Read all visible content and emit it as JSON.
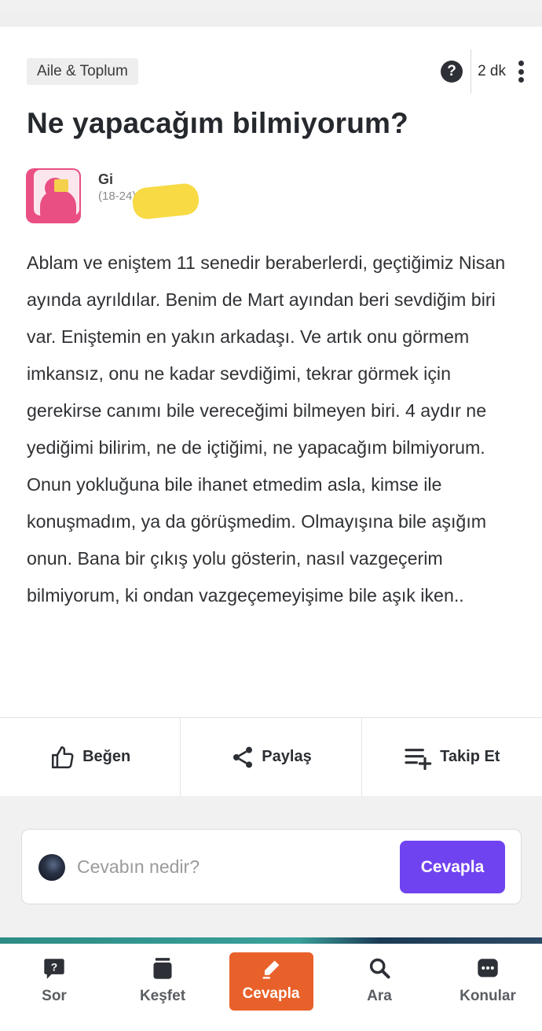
{
  "post": {
    "category": "Aile & Toplum",
    "time": "2 dk",
    "title": "Ne yapacağım bilmiyorum?",
    "author_name": "Gi",
    "author_age": "(18-24)",
    "body": "Ablam ve eniştem 11 senedir beraberlerdi, geçtiğimiz Nisan ayında ayrıldılar. Benim de Mart ayından beri sevdiğim biri var. Eniştemin en yakın arkadaşı. Ve artık onu görmem imkansız, onu ne kadar sevdiğimi, tekrar görmek için gerekirse canımı bile vereceğimi bilmeyen biri. 4 aydır ne yediğimi bilirim, ne de içtiğimi, ne yapacağım bilmiyorum. Onun yokluğuna bile ihanet etmedim asla, kimse ile konuşmadım, ya da görüşmedim. Olmayışına bile aşığım onun. Bana bir çıkış yolu gösterin, nasıl vazgeçerim bilmiyorum, ki ondan vazgeçemeyişime bile aşık iken.."
  },
  "actions": {
    "like": "Beğen",
    "share": "Paylaş",
    "follow": "Takip Et"
  },
  "answer": {
    "placeholder": "Cevabın nedir?",
    "button": "Cevapla"
  },
  "nav": {
    "ask": "Sor",
    "explore": "Keşfet",
    "answer": "Cevapla",
    "search": "Ara",
    "topics": "Konular"
  },
  "colors": {
    "primary": "#7043f0",
    "active_tab": "#e8612a",
    "avatar_pink": "#ea4f84"
  }
}
